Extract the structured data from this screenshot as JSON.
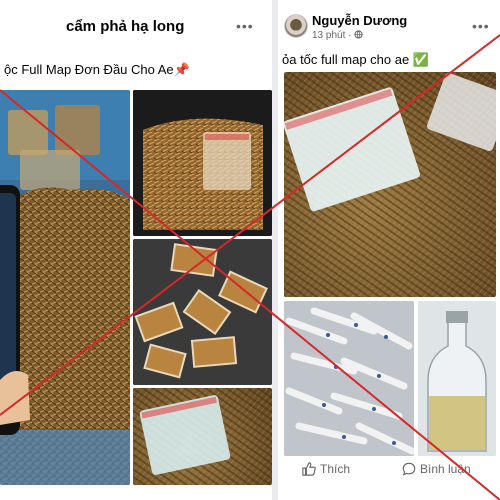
{
  "left_post": {
    "group_name": "cẩm phả hạ long",
    "more": "•••",
    "caption": "ộc Full Map Đơn Đầu Cho Ae",
    "caption_emoji": "📌"
  },
  "right_post": {
    "author": "Nguyễn Dương",
    "time": "13 phút",
    "audience_icon": "globe-icon",
    "more": "•••",
    "caption": "ỏa tốc full map cho ae",
    "caption_emoji": "✅",
    "actions": {
      "like_label": "Thích",
      "comment_label": "Bình luận"
    }
  },
  "overlay": {
    "cross_color": "#d62828"
  },
  "colors": {
    "text_primary": "#050505",
    "text_secondary": "#65676b",
    "background": "#e9ebee"
  }
}
